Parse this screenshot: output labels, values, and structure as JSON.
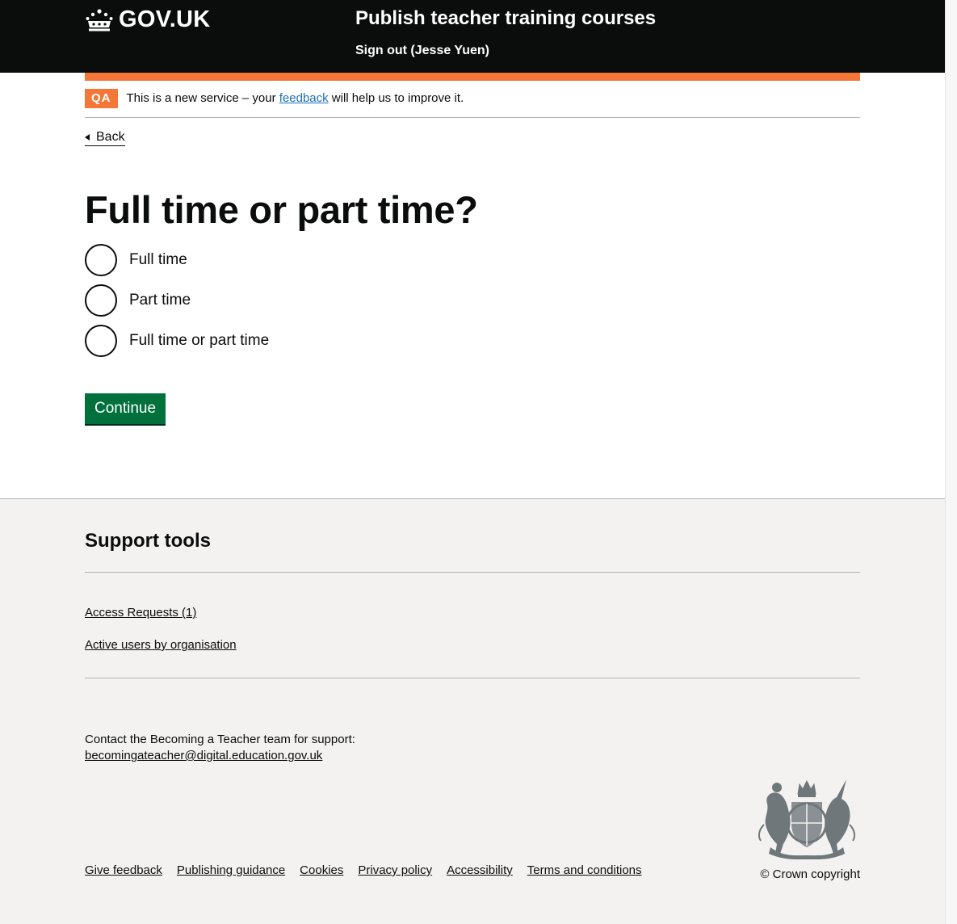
{
  "header": {
    "logo_text": "GOV.UK",
    "service_name": "Publish teacher training courses",
    "signout_label": "Sign out (Jesse Yuen)"
  },
  "phase_banner": {
    "tag": "QA",
    "text_before": "This is a new service – your ",
    "link": "feedback",
    "text_after": " will help us to improve it."
  },
  "back_link": "Back",
  "form": {
    "title": "Full time or part time?",
    "options": [
      {
        "label": "Full time",
        "checked": false
      },
      {
        "label": "Part time",
        "checked": false
      },
      {
        "label": "Full time or part time",
        "checked": false
      }
    ],
    "continue_label": "Continue"
  },
  "footer": {
    "support_heading": "Support tools",
    "support_links": [
      "Access Requests (1)",
      "Active users by organisation"
    ],
    "contact_text": "Contact the Becoming a Teacher team for support:",
    "contact_email": "becomingateacher@digital.education.gov.uk",
    "meta_links": [
      "Give feedback",
      "Publishing guidance",
      "Cookies",
      "Privacy policy",
      "Accessibility",
      "Terms and conditions"
    ],
    "copyright": "© Crown copyright"
  },
  "colors": {
    "header_bg": "#0b0c0c",
    "phase_accent": "#f47738",
    "link": "#1d70b8",
    "button": "#00703c",
    "footer_bg": "#f3f2f1"
  },
  "icons": {
    "logo": "crown-icon",
    "back": "triangle-left-icon",
    "crest": "royal-coat-of-arms-icon"
  }
}
